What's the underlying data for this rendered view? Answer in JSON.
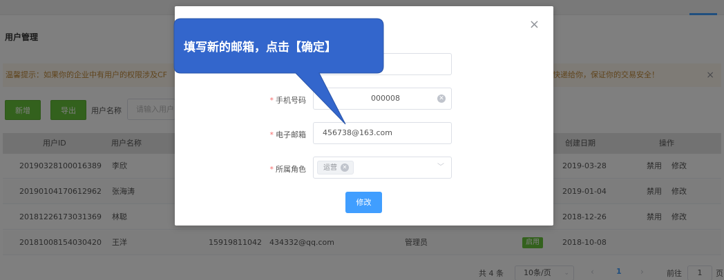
{
  "page": {
    "title": "用户管理",
    "alert_left": "温馨提示：如果你的企业中有用户的权限涉及CF",
    "alert_right": "快递给你，保证你的交易安全！",
    "alert_close": "×",
    "add_button": "新增",
    "export_button": "导出",
    "username_label": "用户名称",
    "username_placeholder": "请输入用户",
    "columns": {
      "user_id": "用户ID",
      "username": "用户名称",
      "created": "创建日期",
      "actions": "操作"
    },
    "rows": [
      {
        "id": "20190328100016389",
        "name": "李欣",
        "phone": "",
        "email": "",
        "role": "",
        "status": "",
        "date": "2019-03-28",
        "disable": "禁用",
        "edit": "修改"
      },
      {
        "id": "20190104170612962",
        "name": "张海涛",
        "phone": "",
        "email": "",
        "role": "",
        "status": "",
        "date": "2019-01-04",
        "disable": "禁用",
        "edit": "修改"
      },
      {
        "id": "20181226173031369",
        "name": "林聪",
        "phone": "",
        "email": "",
        "role": "",
        "status": "",
        "date": "2018-12-26",
        "disable": "禁用",
        "edit": "修改"
      },
      {
        "id": "20181008154030420",
        "name": "王洋",
        "phone": "15919811042",
        "email": "434332@qq.com",
        "role": "管理员",
        "status": "启用",
        "date": "2018-10-08",
        "disable": "",
        "edit": ""
      }
    ],
    "pager": {
      "total": "共 4 条",
      "page_size": "10条/页",
      "prev": "‹",
      "current_page": "1",
      "next": "›",
      "goto_label": "前往",
      "goto_value": "1",
      "goto_suffix": "页"
    }
  },
  "dialog": {
    "close": "×",
    "phone_label": "手机号码",
    "phone_value": "000008",
    "email_label": "电子邮箱",
    "email_value": "456738@163.com",
    "role_label": "所属角色",
    "role_tag": "运营",
    "submit": "修改"
  },
  "callout": {
    "text": "填写新的邮箱，点击【确定】",
    "color": "#3366cc"
  },
  "colors": {
    "green": "#67c23a",
    "blue": "#409eff",
    "required": "#f56c6c"
  }
}
